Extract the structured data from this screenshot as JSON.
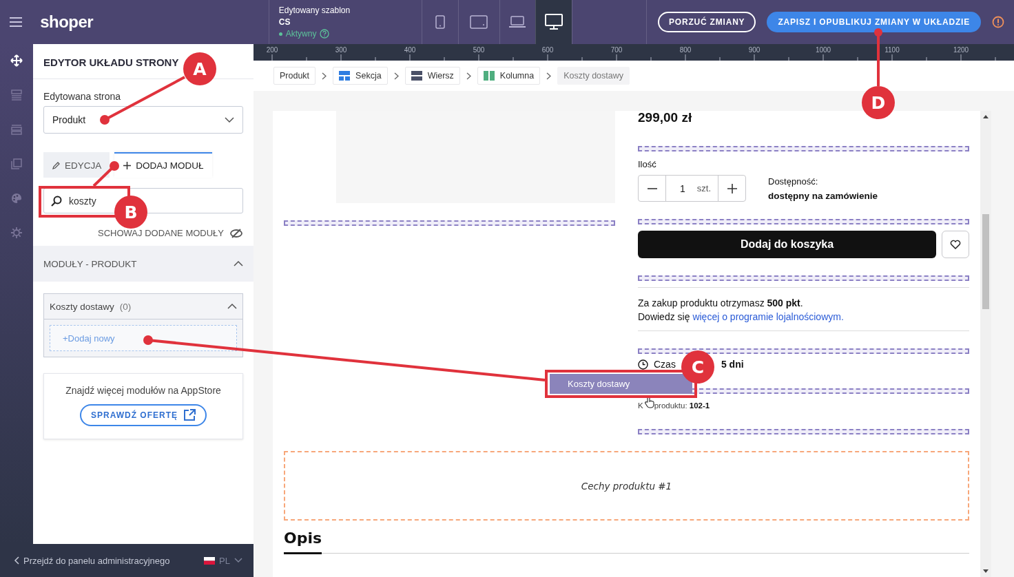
{
  "topbar": {
    "logo": "shoper",
    "template_label": "Edytowany szablon",
    "template_name": "CS",
    "template_status": "Aktywny",
    "devices": [
      {
        "kind": "phone",
        "selected": false
      },
      {
        "kind": "tablet",
        "selected": false
      },
      {
        "kind": "laptop",
        "selected": false
      },
      {
        "kind": "desktop",
        "selected": true
      }
    ],
    "discard_button": "PORZUĆ ZMIANY",
    "publish_button": "ZAPISZ I OPUBLIKUJ ZMIANY W UKŁADZIE"
  },
  "rail": [
    {
      "kind": "move",
      "selected": true
    },
    {
      "kind": "layers",
      "selected": false
    },
    {
      "kind": "rows",
      "selected": false
    },
    {
      "kind": "copy",
      "selected": false
    },
    {
      "kind": "palette",
      "selected": false
    },
    {
      "kind": "settings",
      "selected": false
    }
  ],
  "panel": {
    "title": "EDYTOR UKŁADU STRONY",
    "page_label": "Edytowana strona",
    "page_select": "Produkt",
    "tabs": [
      {
        "label": "EDYCJA",
        "kind": "edit",
        "selected": false
      },
      {
        "label": "DODAJ MODUŁ",
        "kind": "add",
        "selected": true
      }
    ],
    "search": {
      "value": "koszty"
    },
    "hide_added": "SCHOWAJ DODANE MODUŁY",
    "section": {
      "title": "MODUŁY - PRODUKT",
      "expanded": true
    },
    "modules": [
      {
        "name": "Koszty dostawy",
        "count": "(0)",
        "expanded": true,
        "add_new": "+Dodaj nowy"
      }
    ],
    "appstore": {
      "text": "Znajdź więcej modułów na AppStore",
      "button": "SPRAWDŹ OFERTĘ"
    }
  },
  "footer": {
    "back_link": "Przejdź do panelu administracyjnego",
    "language": "PL"
  },
  "ruler": [
    "200",
    "300",
    "400",
    "500",
    "600",
    "700",
    "800",
    "900",
    "1000",
    "1100",
    "1200"
  ],
  "breadcrumbs": [
    {
      "label": "Produkt",
      "kind": "plain"
    },
    {
      "label": "Sekcja",
      "kind": "section"
    },
    {
      "label": "Wiersz",
      "kind": "row"
    },
    {
      "label": "Kolumna",
      "kind": "column"
    },
    {
      "label": "Koszty dostawy",
      "kind": "current"
    }
  ],
  "page": {
    "price": "299,00 zł",
    "quantity_label": "Ilość",
    "quantity": "1",
    "unit": "szt.",
    "availability_label": "Dostępność:",
    "availability": "dostępny na zamówienie",
    "add_to_cart": "Dodaj do koszyka",
    "loyalty_text": "Za zakup produktu otrzymasz **500 pkt**.",
    "loyalty_prefix": "Dowiedz się",
    "loyalty_link": "więcej o programie lojalnościowym.",
    "delivery_label": "Czas",
    "delivery_value": "5 dni",
    "code_prefix": "K",
    "code_label": "produktu:",
    "code_value": "102-1",
    "features": "Cechy produktu #1",
    "description_title": "Opis"
  },
  "drag_ghost": "Koszty dostawy",
  "callouts": [
    "A",
    "B",
    "C",
    "D"
  ]
}
